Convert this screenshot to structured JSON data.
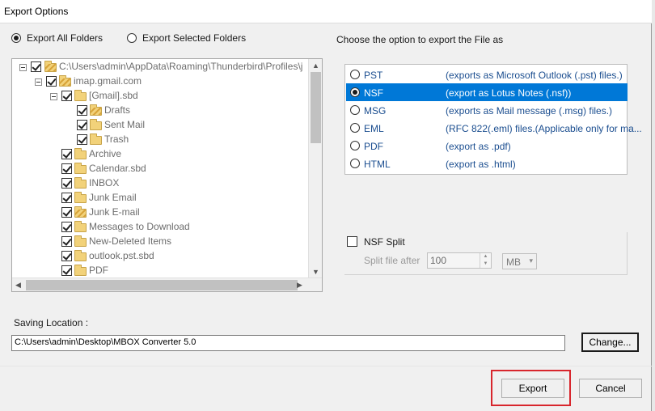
{
  "window": {
    "title": "Export Options"
  },
  "scope": {
    "all_label": "Export All Folders",
    "selected_label": "Export Selected Folders",
    "selected": "all"
  },
  "tree": {
    "root_path": "C:\\Users\\admin\\AppData\\Roaming\\Thunderbird\\Profiles\\j",
    "account": "imap.gmail.com",
    "gmail_folder": "[Gmail].sbd",
    "gmail_children": [
      "Drafts",
      "Sent Mail",
      "Trash"
    ],
    "folders": [
      "Archive",
      "Calendar.sbd",
      "INBOX",
      "Junk Email",
      "Junk E-mail",
      "Messages to Download",
      "New-Deleted Items",
      "outlook.pst.sbd",
      "PDF"
    ]
  },
  "export_as": {
    "heading": "Choose the option to export the File as",
    "selected": "NSF",
    "options": [
      {
        "name": "PST",
        "desc": "(exports as Microsoft Outlook (.pst) files.)"
      },
      {
        "name": "NSF",
        "desc": "(export as Lotus Notes (.nsf))"
      },
      {
        "name": "MSG",
        "desc": "(exports as Mail message (.msg) files.)"
      },
      {
        "name": "EML",
        "desc": "(RFC 822(.eml) files.(Applicable only for ma..."
      },
      {
        "name": "PDF",
        "desc": "(export as .pdf)"
      },
      {
        "name": "HTML",
        "desc": "(export as .html)"
      }
    ]
  },
  "split": {
    "label": "NSF Split",
    "after_label": "Split file after",
    "value": "100",
    "unit": "MB"
  },
  "saving": {
    "label": "Saving Location :",
    "path": "C:\\Users\\admin\\Desktop\\MBOX Converter 5.0",
    "change_label": "Change..."
  },
  "actions": {
    "export_label": "Export",
    "cancel_label": "Cancel"
  }
}
